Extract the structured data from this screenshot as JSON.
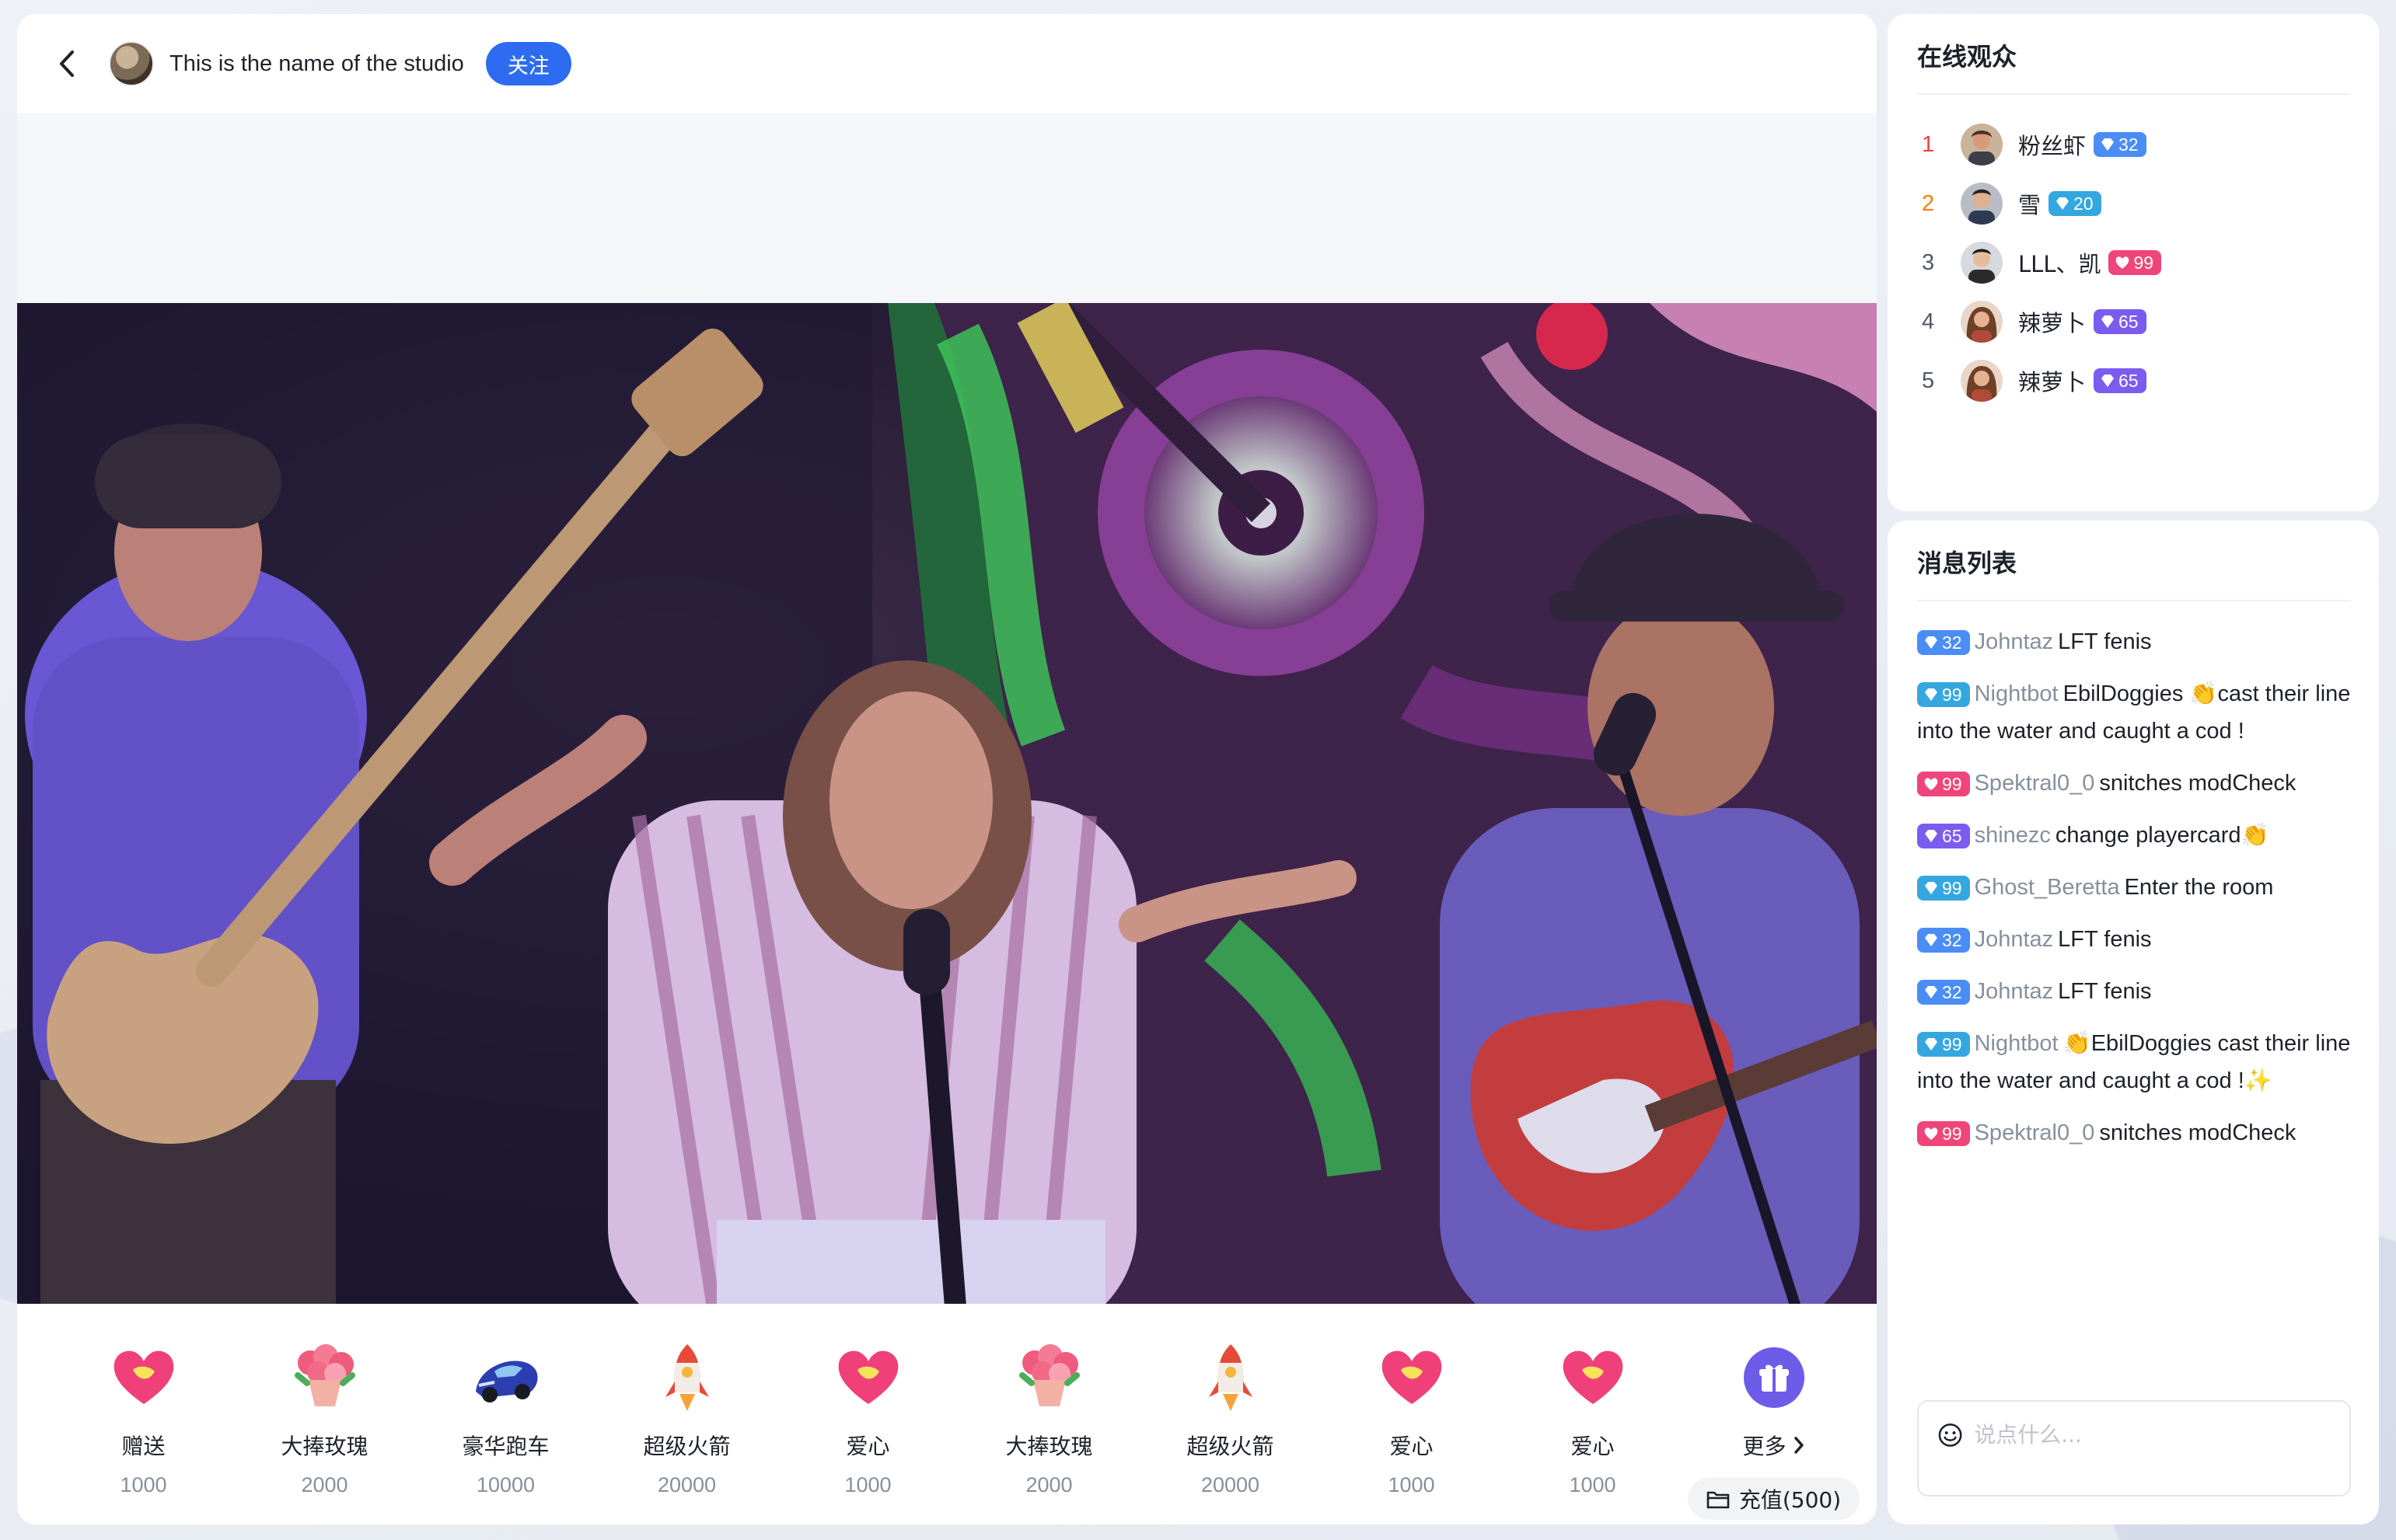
{
  "header": {
    "studio_name": "This is the name of the studio",
    "follow_label": "关注"
  },
  "gifts": [
    {
      "name": "赠送",
      "price": "1000",
      "icon": "heart-icon"
    },
    {
      "name": "大捧玫瑰",
      "price": "2000",
      "icon": "rose-bouquet-icon"
    },
    {
      "name": "豪华跑车",
      "price": "10000",
      "icon": "sports-car-icon"
    },
    {
      "name": "超级火箭",
      "price": "20000",
      "icon": "rocket-icon"
    },
    {
      "name": "爱心",
      "price": "1000",
      "icon": "heart-icon"
    },
    {
      "name": "大捧玫瑰",
      "price": "2000",
      "icon": "rose-bouquet-icon"
    },
    {
      "name": "超级火箭",
      "price": "20000",
      "icon": "rocket-icon"
    },
    {
      "name": "爱心",
      "price": "1000",
      "icon": "heart-icon"
    },
    {
      "name": "爱心",
      "price": "1000",
      "icon": "heart-icon"
    }
  ],
  "more": {
    "label": "更多",
    "recharge_label": "充值(500)"
  },
  "audience": {
    "title": "在线观众",
    "items": [
      {
        "rank": "1",
        "name": "粉丝虾",
        "badge": "32",
        "badge_color": "#4a8df6",
        "rank_color": "#f53f3f"
      },
      {
        "rank": "2",
        "name": "雪",
        "badge": "20",
        "badge_color": "#35a7e0",
        "rank_color": "#ff7d00"
      },
      {
        "rank": "3",
        "name": "LLL、凯",
        "badge": "99",
        "badge_color": "#f0457a",
        "rank_color": "#4e5969"
      },
      {
        "rank": "4",
        "name": "辣萝卜",
        "badge": "65",
        "badge_color": "#7b5cf0",
        "rank_color": "#4e5969"
      },
      {
        "rank": "5",
        "name": "辣萝卜",
        "badge": "65",
        "badge_color": "#7b5cf0",
        "rank_color": "#4e5969"
      }
    ]
  },
  "chat": {
    "title": "消息列表",
    "messages": [
      {
        "badge": "32",
        "badge_color": "#4a8df6",
        "user": "Johntaz",
        "text": "LFT fenis"
      },
      {
        "badge": "99",
        "badge_color": "#35a7e0",
        "user": "Nightbot",
        "text": "EbilDoggies 👏cast their line into the water and caught a cod !"
      },
      {
        "badge": "99",
        "badge_color": "#f0457a",
        "user": "Spektral0_0",
        "text": "snitches modCheck"
      },
      {
        "badge": "65",
        "badge_color": "#7b5cf0",
        "user": "shinezc",
        "text": "change playercard👏"
      },
      {
        "badge": "99",
        "badge_color": "#35a7e0",
        "user": "Ghost_Beretta",
        "text": "Enter the room"
      },
      {
        "badge": "32",
        "badge_color": "#4a8df6",
        "user": "Johntaz",
        "text": "LFT fenis"
      },
      {
        "badge": "32",
        "badge_color": "#4a8df6",
        "user": "Johntaz",
        "text": "LFT fenis"
      },
      {
        "badge": "99",
        "badge_color": "#35a7e0",
        "user": "Nightbot",
        "text": "👏EbilDoggies cast their line into the water and caught a cod !✨"
      },
      {
        "badge": "99",
        "badge_color": "#f0457a",
        "user": "Spektral0_0",
        "text": "snitches modCheck"
      }
    ],
    "input_placeholder": "说点什么..."
  }
}
